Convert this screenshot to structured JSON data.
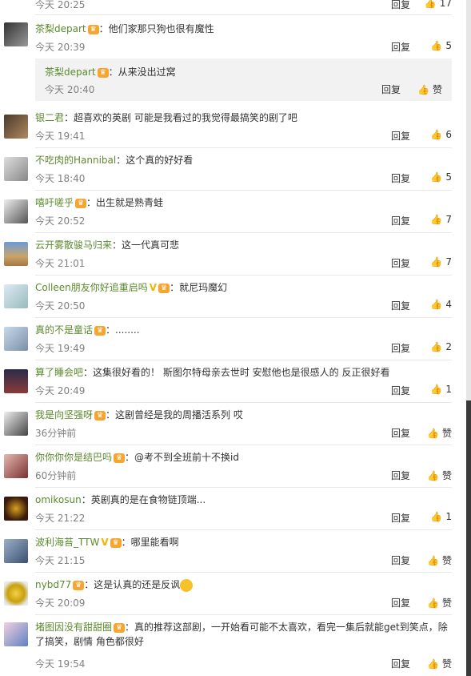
{
  "reply_label": "回复",
  "like_icon": "thumb-up-icon",
  "top_meta": {
    "time": "今天 20:25",
    "likes": "17"
  },
  "comments": [
    {
      "user": "茶梨depart",
      "badge": true,
      "vip": false,
      "text": "：他们家那只狗也很有魔性",
      "time": "今天 20:39",
      "likes": "5",
      "sub": {
        "user": "茶梨depart",
        "badge": true,
        "text": "：从来没出过窝",
        "time": "今天 20:40",
        "likes": "赞"
      }
    },
    {
      "user": "银二君",
      "badge": false,
      "vip": false,
      "text": "：超喜欢的英剧 可能是我看过的我觉得最搞笑的剧了吧",
      "time": "今天 19:41",
      "likes": "6"
    },
    {
      "user": "不吃肉的Hannibal",
      "badge": false,
      "vip": false,
      "text": "：这个真的好好看",
      "time": "今天 18:40",
      "likes": "5"
    },
    {
      "user": "嘻吁嗟乎",
      "badge": true,
      "vip": false,
      "text": "：出生就是熟青蛙",
      "time": "今天 20:52",
      "likes": "7"
    },
    {
      "user": "云开雾散骏马归来",
      "badge": false,
      "vip": false,
      "text": "：这一代真可悲",
      "time": "今天 21:01",
      "likes": "7"
    },
    {
      "user": "Colleen朋友你好追重启吗",
      "badge": true,
      "vip": true,
      "text": "：就尼玛魔幻",
      "time": "今天 20:50",
      "likes": "4"
    },
    {
      "user": "真的不是童话",
      "badge": true,
      "vip": false,
      "text": "：........",
      "time": "今天 19:49",
      "likes": "2"
    },
    {
      "user": "算了睡会吧",
      "badge": false,
      "vip": false,
      "text": "：这集很好看的！  斯图尔特母亲去世时  安慰他也是很感人的  反正很好看",
      "time": "今天 20:49",
      "likes": "1"
    },
    {
      "user": "我是向坚强呀",
      "badge": true,
      "vip": false,
      "text": "：这剧曾经是我的周播活系列 哎",
      "time": "36分钟前",
      "likes": "赞"
    },
    {
      "user": "你你你你是结巴吗",
      "badge": true,
      "vip": false,
      "text": "：@考不到全班前十不换id",
      "time": "60分钟前",
      "likes": "赞"
    },
    {
      "user": "omikosun",
      "badge": false,
      "vip": false,
      "text": "：英剧真的是在食物链顶端...",
      "time": "今天 21:22",
      "likes": "1"
    },
    {
      "user": "波利海苔_TTW",
      "badge": true,
      "vip": true,
      "text": "：哪里能看啊",
      "time": "今天 21:15",
      "likes": "赞"
    },
    {
      "user": "nybd77",
      "badge": true,
      "vip": false,
      "text": "：这是认真的还是反讽",
      "emoji": "sweat-smile-emoji",
      "time": "今天 20:09",
      "likes": "赞"
    },
    {
      "user": "堵图因没有甜甜圈",
      "badge": true,
      "vip": false,
      "text": "：真的推荐这部剧，一开始看可能不太喜欢，看完一集后就能get到笑点，除了搞笑，剧情  角色都很好",
      "time": "今天 19:54",
      "likes": "赞"
    }
  ],
  "colors": {
    "username": "#5b8a2d",
    "meta": "#808080",
    "badge": "#f7a531",
    "vip": "#f1b400",
    "subbox": "#f2f2f2"
  }
}
